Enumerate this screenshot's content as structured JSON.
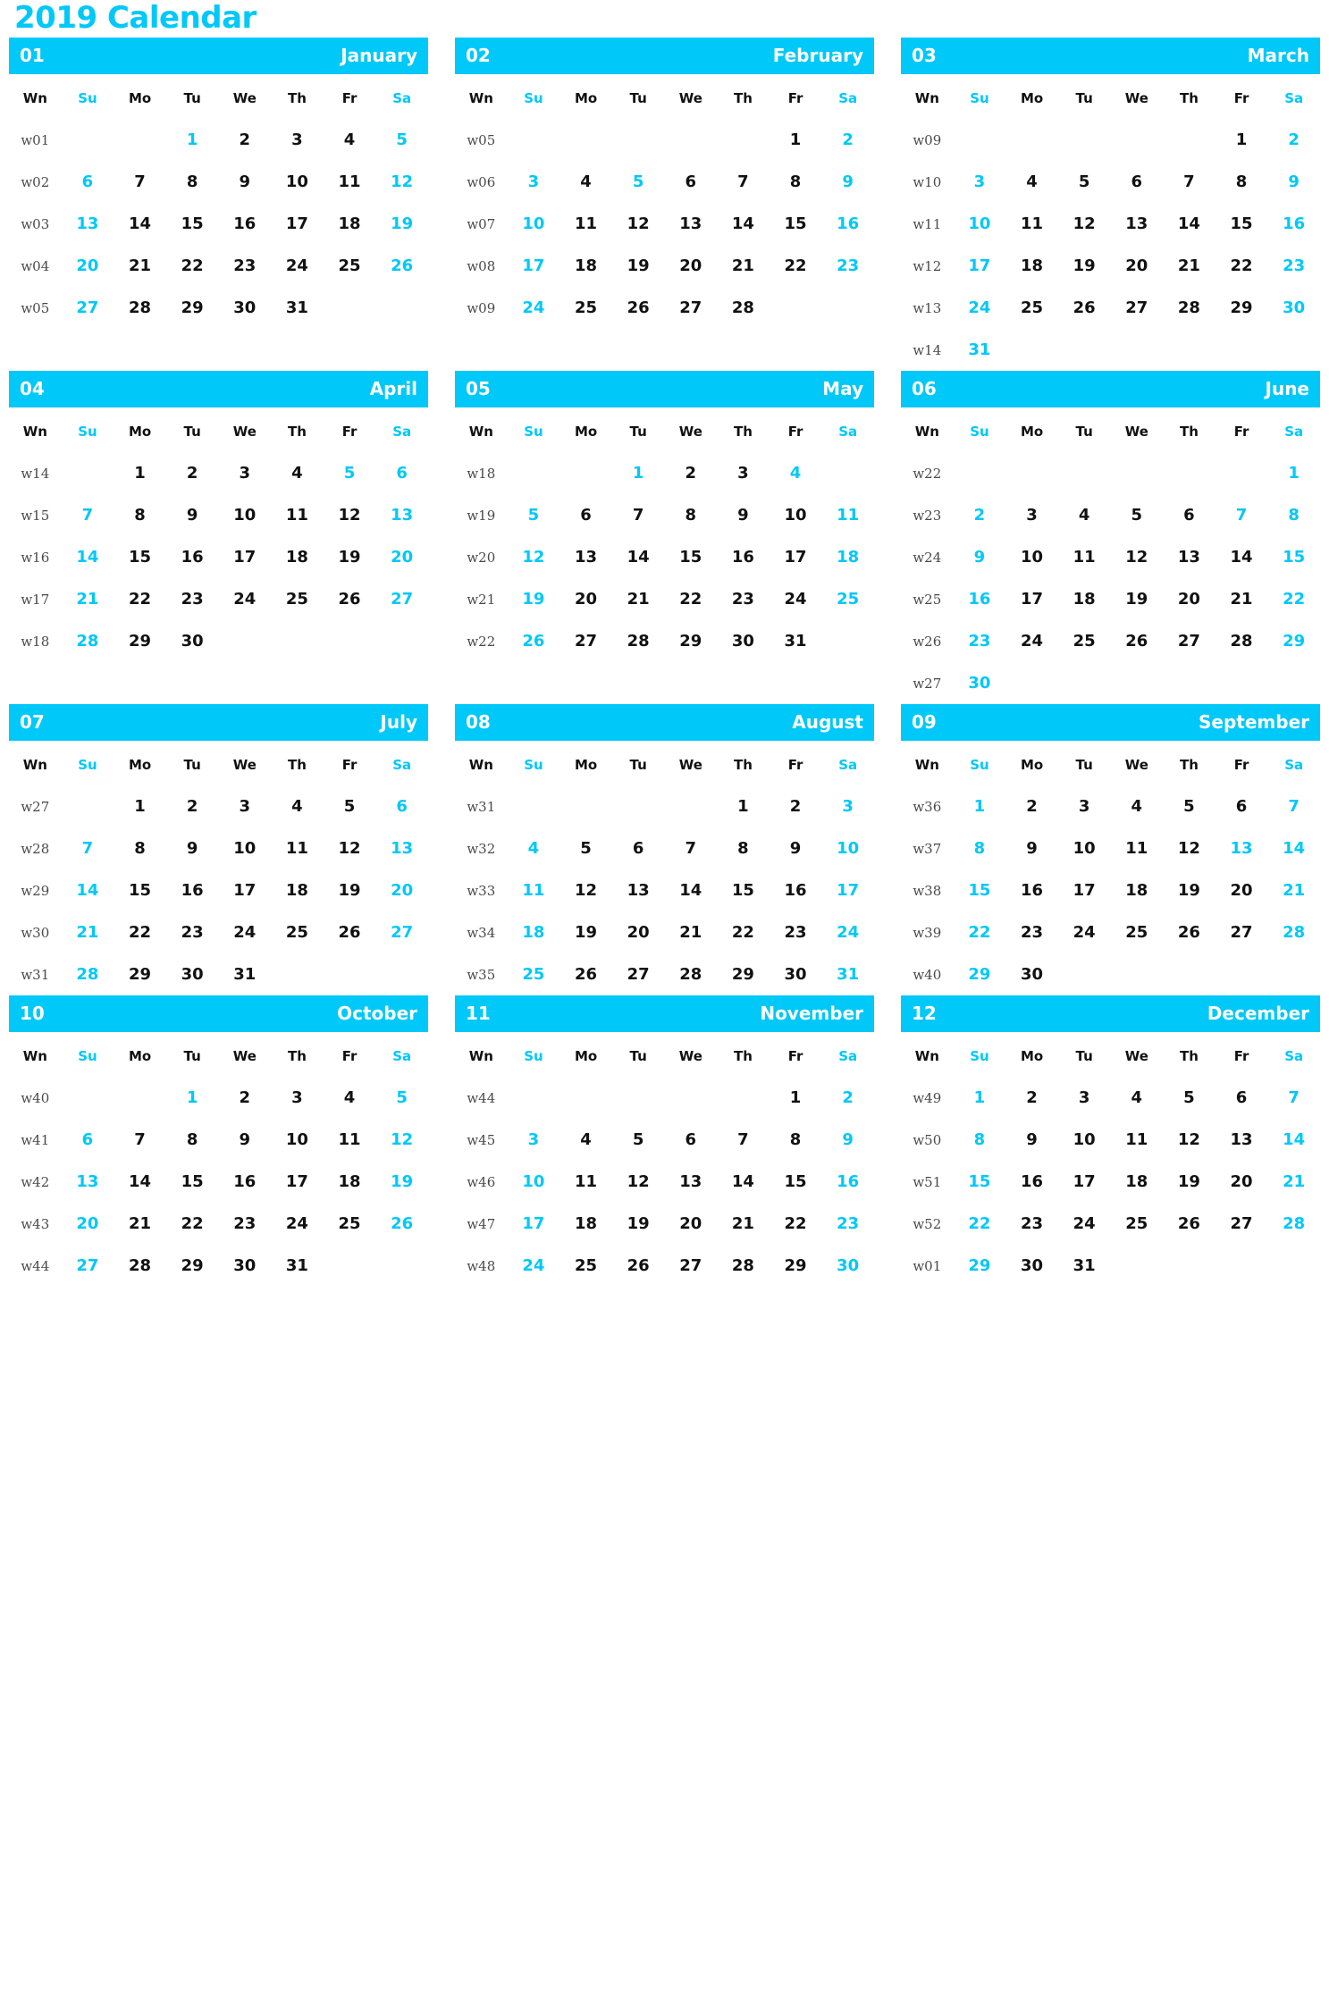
{
  "title": "2019 Calendar",
  "colors": {
    "accent": "#00C8F8",
    "text": "#111111",
    "week_number": "#4a4a4a",
    "header_text": "#ffffff"
  },
  "day_headers": [
    "Wn",
    "Su",
    "Mo",
    "Tu",
    "We",
    "Th",
    "Fr",
    "Sa"
  ],
  "weekend_columns": [
    1,
    7
  ],
  "months": [
    {
      "number": "01",
      "name": "January",
      "weeks": [
        {
          "wn": "w01",
          "days": [
            "",
            "",
            "1",
            "2",
            "3",
            "4",
            "5"
          ],
          "hl": [
            2,
            6
          ]
        },
        {
          "wn": "w02",
          "days": [
            "6",
            "7",
            "8",
            "9",
            "10",
            "11",
            "12"
          ],
          "hl": [
            0,
            6
          ]
        },
        {
          "wn": "w03",
          "days": [
            "13",
            "14",
            "15",
            "16",
            "17",
            "18",
            "19"
          ],
          "hl": [
            0,
            6
          ]
        },
        {
          "wn": "w04",
          "days": [
            "20",
            "21",
            "22",
            "23",
            "24",
            "25",
            "26"
          ],
          "hl": [
            0,
            6
          ]
        },
        {
          "wn": "w05",
          "days": [
            "27",
            "28",
            "29",
            "30",
            "31",
            "",
            ""
          ],
          "hl": [
            0
          ]
        }
      ]
    },
    {
      "number": "02",
      "name": "February",
      "weeks": [
        {
          "wn": "w05",
          "days": [
            "",
            "",
            "",
            "",
            "",
            "1",
            "2"
          ],
          "hl": [
            6
          ]
        },
        {
          "wn": "w06",
          "days": [
            "3",
            "4",
            "5",
            "6",
            "7",
            "8",
            "9"
          ],
          "hl": [
            0,
            2,
            6
          ]
        },
        {
          "wn": "w07",
          "days": [
            "10",
            "11",
            "12",
            "13",
            "14",
            "15",
            "16"
          ],
          "hl": [
            0,
            6
          ]
        },
        {
          "wn": "w08",
          "days": [
            "17",
            "18",
            "19",
            "20",
            "21",
            "22",
            "23"
          ],
          "hl": [
            0,
            6
          ]
        },
        {
          "wn": "w09",
          "days": [
            "24",
            "25",
            "26",
            "27",
            "28",
            "",
            ""
          ],
          "hl": [
            0
          ]
        }
      ]
    },
    {
      "number": "03",
      "name": "March",
      "weeks": [
        {
          "wn": "w09",
          "days": [
            "",
            "",
            "",
            "",
            "",
            "1",
            "2"
          ],
          "hl": [
            6
          ]
        },
        {
          "wn": "w10",
          "days": [
            "3",
            "4",
            "5",
            "6",
            "7",
            "8",
            "9"
          ],
          "hl": [
            0,
            6
          ]
        },
        {
          "wn": "w11",
          "days": [
            "10",
            "11",
            "12",
            "13",
            "14",
            "15",
            "16"
          ],
          "hl": [
            0,
            6
          ]
        },
        {
          "wn": "w12",
          "days": [
            "17",
            "18",
            "19",
            "20",
            "21",
            "22",
            "23"
          ],
          "hl": [
            0,
            6
          ]
        },
        {
          "wn": "w13",
          "days": [
            "24",
            "25",
            "26",
            "27",
            "28",
            "29",
            "30"
          ],
          "hl": [
            0,
            6
          ]
        },
        {
          "wn": "w14",
          "days": [
            "31",
            "",
            "",
            "",
            "",
            "",
            ""
          ],
          "hl": [
            0
          ]
        }
      ]
    },
    {
      "number": "04",
      "name": "April",
      "weeks": [
        {
          "wn": "w14",
          "days": [
            "",
            "1",
            "2",
            "3",
            "4",
            "5",
            "6"
          ],
          "hl": [
            5,
            6
          ]
        },
        {
          "wn": "w15",
          "days": [
            "7",
            "8",
            "9",
            "10",
            "11",
            "12",
            "13"
          ],
          "hl": [
            0,
            6
          ]
        },
        {
          "wn": "w16",
          "days": [
            "14",
            "15",
            "16",
            "17",
            "18",
            "19",
            "20"
          ],
          "hl": [
            0,
            6
          ]
        },
        {
          "wn": "w17",
          "days": [
            "21",
            "22",
            "23",
            "24",
            "25",
            "26",
            "27"
          ],
          "hl": [
            0,
            6
          ]
        },
        {
          "wn": "w18",
          "days": [
            "28",
            "29",
            "30",
            "",
            "",
            "",
            ""
          ],
          "hl": [
            0
          ]
        }
      ]
    },
    {
      "number": "05",
      "name": "May",
      "weeks": [
        {
          "wn": "w18",
          "days": [
            "",
            "",
            "1",
            "2",
            "3",
            "4",
            ""
          ],
          "hl": [
            2,
            5
          ]
        },
        {
          "wn": "w19",
          "days": [
            "5",
            "6",
            "7",
            "8",
            "9",
            "10",
            "11"
          ],
          "hl": [
            0,
            6
          ]
        },
        {
          "wn": "w20",
          "days": [
            "12",
            "13",
            "14",
            "15",
            "16",
            "17",
            "18"
          ],
          "hl": [
            0,
            6
          ]
        },
        {
          "wn": "w21",
          "days": [
            "19",
            "20",
            "21",
            "22",
            "23",
            "24",
            "25"
          ],
          "hl": [
            0,
            6
          ]
        },
        {
          "wn": "w22",
          "days": [
            "26",
            "27",
            "28",
            "29",
            "30",
            "31",
            ""
          ],
          "hl": [
            0
          ]
        }
      ]
    },
    {
      "number": "06",
      "name": "June",
      "weeks": [
        {
          "wn": "w22",
          "days": [
            "",
            "",
            "",
            "",
            "",
            "",
            "1"
          ],
          "hl": [
            6
          ]
        },
        {
          "wn": "w23",
          "days": [
            "2",
            "3",
            "4",
            "5",
            "6",
            "7",
            "8"
          ],
          "hl": [
            0,
            5,
            6
          ]
        },
        {
          "wn": "w24",
          "days": [
            "9",
            "10",
            "11",
            "12",
            "13",
            "14",
            "15"
          ],
          "hl": [
            0,
            6
          ]
        },
        {
          "wn": "w25",
          "days": [
            "16",
            "17",
            "18",
            "19",
            "20",
            "21",
            "22"
          ],
          "hl": [
            0,
            6
          ]
        },
        {
          "wn": "w26",
          "days": [
            "23",
            "24",
            "25",
            "26",
            "27",
            "28",
            "29"
          ],
          "hl": [
            0,
            6
          ]
        },
        {
          "wn": "w27",
          "days": [
            "30",
            "",
            "",
            "",
            "",
            "",
            ""
          ],
          "hl": [
            0
          ]
        }
      ]
    },
    {
      "number": "07",
      "name": "July",
      "weeks": [
        {
          "wn": "w27",
          "days": [
            "",
            "1",
            "2",
            "3",
            "4",
            "5",
            "6"
          ],
          "hl": [
            6
          ]
        },
        {
          "wn": "w28",
          "days": [
            "7",
            "8",
            "9",
            "10",
            "11",
            "12",
            "13"
          ],
          "hl": [
            0,
            6
          ]
        },
        {
          "wn": "w29",
          "days": [
            "14",
            "15",
            "16",
            "17",
            "18",
            "19",
            "20"
          ],
          "hl": [
            0,
            6
          ]
        },
        {
          "wn": "w30",
          "days": [
            "21",
            "22",
            "23",
            "24",
            "25",
            "26",
            "27"
          ],
          "hl": [
            0,
            6
          ]
        },
        {
          "wn": "w31",
          "days": [
            "28",
            "29",
            "30",
            "31",
            "",
            "",
            ""
          ],
          "hl": [
            0
          ]
        }
      ]
    },
    {
      "number": "08",
      "name": "August",
      "weeks": [
        {
          "wn": "w31",
          "days": [
            "",
            "",
            "",
            "",
            "1",
            "2",
            "3"
          ],
          "hl": [
            6
          ]
        },
        {
          "wn": "w32",
          "days": [
            "4",
            "5",
            "6",
            "7",
            "8",
            "9",
            "10"
          ],
          "hl": [
            0,
            6
          ]
        },
        {
          "wn": "w33",
          "days": [
            "11",
            "12",
            "13",
            "14",
            "15",
            "16",
            "17"
          ],
          "hl": [
            0,
            6
          ]
        },
        {
          "wn": "w34",
          "days": [
            "18",
            "19",
            "20",
            "21",
            "22",
            "23",
            "24"
          ],
          "hl": [
            0,
            6
          ]
        },
        {
          "wn": "w35",
          "days": [
            "25",
            "26",
            "27",
            "28",
            "29",
            "30",
            "31"
          ],
          "hl": [
            0,
            6
          ]
        }
      ]
    },
    {
      "number": "09",
      "name": "September",
      "weeks": [
        {
          "wn": "w36",
          "days": [
            "1",
            "2",
            "3",
            "4",
            "5",
            "6",
            "7"
          ],
          "hl": [
            0,
            6
          ]
        },
        {
          "wn": "w37",
          "days": [
            "8",
            "9",
            "10",
            "11",
            "12",
            "13",
            "14"
          ],
          "hl": [
            0,
            5,
            6
          ]
        },
        {
          "wn": "w38",
          "days": [
            "15",
            "16",
            "17",
            "18",
            "19",
            "20",
            "21"
          ],
          "hl": [
            0,
            6
          ]
        },
        {
          "wn": "w39",
          "days": [
            "22",
            "23",
            "24",
            "25",
            "26",
            "27",
            "28"
          ],
          "hl": [
            0,
            6
          ]
        },
        {
          "wn": "w40",
          "days": [
            "29",
            "30",
            "",
            "",
            "",
            "",
            ""
          ],
          "hl": [
            0
          ]
        }
      ]
    },
    {
      "number": "10",
      "name": "October",
      "weeks": [
        {
          "wn": "w40",
          "days": [
            "",
            "",
            "1",
            "2",
            "3",
            "4",
            "5"
          ],
          "hl": [
            2,
            6
          ]
        },
        {
          "wn": "w41",
          "days": [
            "6",
            "7",
            "8",
            "9",
            "10",
            "11",
            "12"
          ],
          "hl": [
            0,
            6
          ]
        },
        {
          "wn": "w42",
          "days": [
            "13",
            "14",
            "15",
            "16",
            "17",
            "18",
            "19"
          ],
          "hl": [
            0,
            6
          ]
        },
        {
          "wn": "w43",
          "days": [
            "20",
            "21",
            "22",
            "23",
            "24",
            "25",
            "26"
          ],
          "hl": [
            0,
            6
          ]
        },
        {
          "wn": "w44",
          "days": [
            "27",
            "28",
            "29",
            "30",
            "31",
            "",
            ""
          ],
          "hl": [
            0
          ]
        }
      ]
    },
    {
      "number": "11",
      "name": "November",
      "weeks": [
        {
          "wn": "w44",
          "days": [
            "",
            "",
            "",
            "",
            "",
            "1",
            "2"
          ],
          "hl": [
            6
          ]
        },
        {
          "wn": "w45",
          "days": [
            "3",
            "4",
            "5",
            "6",
            "7",
            "8",
            "9"
          ],
          "hl": [
            0,
            6
          ]
        },
        {
          "wn": "w46",
          "days": [
            "10",
            "11",
            "12",
            "13",
            "14",
            "15",
            "16"
          ],
          "hl": [
            0,
            6
          ]
        },
        {
          "wn": "w47",
          "days": [
            "17",
            "18",
            "19",
            "20",
            "21",
            "22",
            "23"
          ],
          "hl": [
            0,
            6
          ]
        },
        {
          "wn": "w48",
          "days": [
            "24",
            "25",
            "26",
            "27",
            "28",
            "29",
            "30"
          ],
          "hl": [
            0,
            6
          ]
        }
      ]
    },
    {
      "number": "12",
      "name": "December",
      "weeks": [
        {
          "wn": "w49",
          "days": [
            "1",
            "2",
            "3",
            "4",
            "5",
            "6",
            "7"
          ],
          "hl": [
            0,
            6
          ]
        },
        {
          "wn": "w50",
          "days": [
            "8",
            "9",
            "10",
            "11",
            "12",
            "13",
            "14"
          ],
          "hl": [
            0,
            6
          ]
        },
        {
          "wn": "w51",
          "days": [
            "15",
            "16",
            "17",
            "18",
            "19",
            "20",
            "21"
          ],
          "hl": [
            0,
            6
          ]
        },
        {
          "wn": "w52",
          "days": [
            "22",
            "23",
            "24",
            "25",
            "26",
            "27",
            "28"
          ],
          "hl": [
            0,
            6
          ]
        },
        {
          "wn": "w01",
          "days": [
            "29",
            "30",
            "31",
            "",
            "",
            "",
            ""
          ],
          "hl": [
            0
          ]
        }
      ]
    }
  ]
}
